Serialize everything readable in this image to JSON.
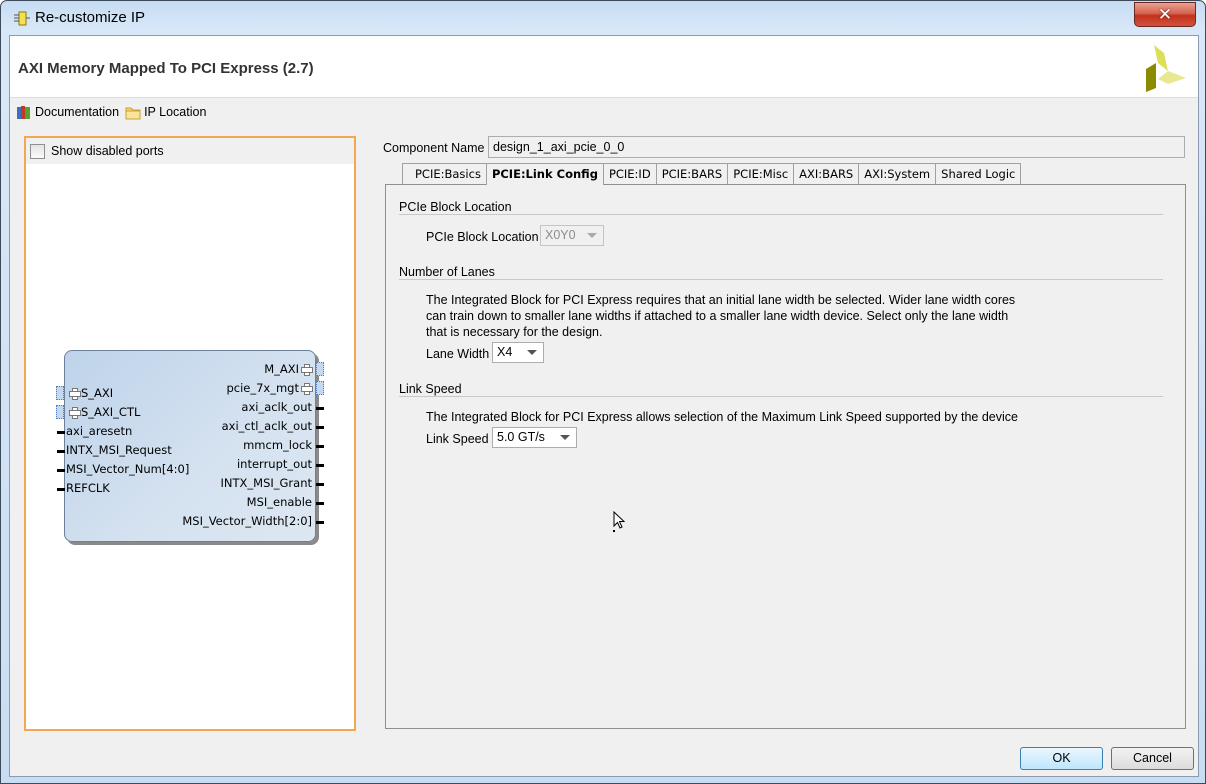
{
  "window": {
    "title": "Re-customize IP",
    "close_label": "✕"
  },
  "header": {
    "title": "AXI Memory Mapped To PCI Express (2.7)"
  },
  "toolbar": {
    "documentation_label": "Documentation",
    "ip_location_label": "IP Location"
  },
  "symbol_panel": {
    "show_disabled_ports_label": "Show disabled ports",
    "show_disabled_ports_checked": false,
    "left_ports": [
      {
        "name": "S_AXI",
        "kind": "bus"
      },
      {
        "name": "S_AXI_CTL",
        "kind": "bus"
      },
      {
        "name": "axi_aresetn",
        "kind": "pin"
      },
      {
        "name": "INTX_MSI_Request",
        "kind": "pin"
      },
      {
        "name": "MSI_Vector_Num[4:0]",
        "kind": "pin"
      },
      {
        "name": "REFCLK",
        "kind": "pin"
      }
    ],
    "right_ports": [
      {
        "name": "M_AXI",
        "kind": "bus"
      },
      {
        "name": "pcie_7x_mgt",
        "kind": "bus"
      },
      {
        "name": "axi_aclk_out",
        "kind": "pin"
      },
      {
        "name": "axi_ctl_aclk_out",
        "kind": "pin"
      },
      {
        "name": "mmcm_lock",
        "kind": "pin"
      },
      {
        "name": "interrupt_out",
        "kind": "pin"
      },
      {
        "name": "INTX_MSI_Grant",
        "kind": "pin"
      },
      {
        "name": "MSI_enable",
        "kind": "pin"
      },
      {
        "name": "MSI_Vector_Width[2:0]",
        "kind": "pin"
      }
    ]
  },
  "component": {
    "label": "Component Name",
    "value": "design_1_axi_pcie_0_0"
  },
  "tabs": [
    {
      "label": "PCIE:Basics",
      "active": false
    },
    {
      "label": "PCIE:Link Config",
      "active": true
    },
    {
      "label": "PCIE:ID",
      "active": false
    },
    {
      "label": "PCIE:BARS",
      "active": false
    },
    {
      "label": "PCIE:Misc",
      "active": false
    },
    {
      "label": "AXI:BARS",
      "active": false
    },
    {
      "label": "AXI:System",
      "active": false
    },
    {
      "label": "Shared Logic",
      "active": false
    }
  ],
  "link_config": {
    "block_location": {
      "section_title": "PCIe Block Location",
      "field_label": "PCIe Block Location",
      "value": "X0Y0",
      "disabled": true
    },
    "lanes": {
      "section_title": "Number of Lanes",
      "description": "The Integrated Block for PCI Express requires that an initial lane width be selected. Wider lane width cores can train down to smaller lane widths if attached to a smaller lane width device. Select only the lane width that is necessary for the design.",
      "field_label": "Lane Width",
      "value": "X4"
    },
    "speed": {
      "section_title": "Link Speed",
      "description": "The Integrated Block for PCI Express allows selection of the Maximum Link Speed supported by the device",
      "field_label": "Link Speed",
      "value": "5.0 GT/s"
    }
  },
  "footer": {
    "ok_label": "OK",
    "cancel_label": "Cancel"
  }
}
